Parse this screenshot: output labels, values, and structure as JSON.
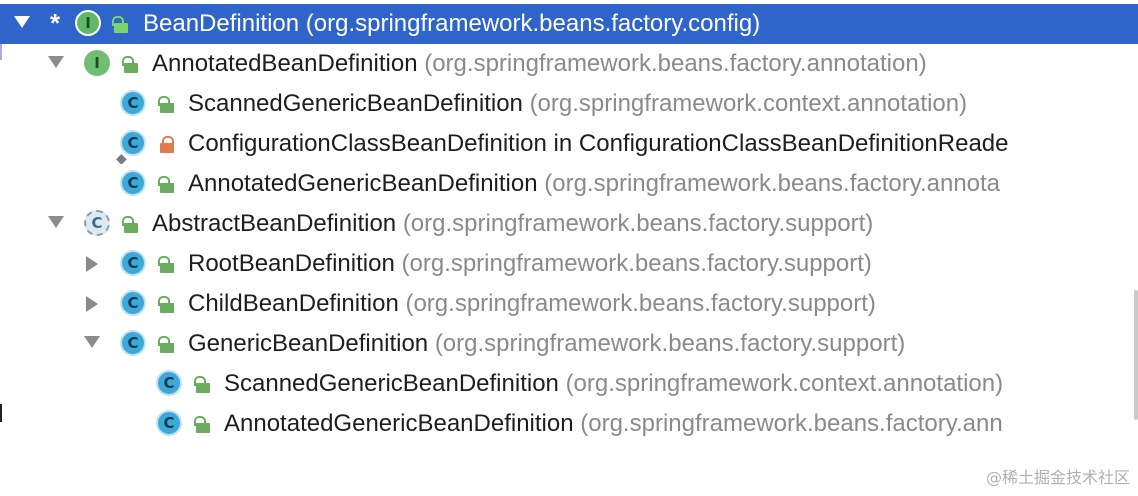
{
  "tree": {
    "rows": [
      {
        "name": "BeanDefinition",
        "pkg": "(org.springframework.beans.factory.config)",
        "kind_letter": "I",
        "kind": "interface",
        "visibility": "public",
        "expanded": true,
        "selected": true,
        "star": "*"
      },
      {
        "name": "AnnotatedBeanDefinition",
        "pkg": "(org.springframework.beans.factory.annotation)",
        "kind_letter": "I",
        "kind": "interface",
        "visibility": "public",
        "expanded": true
      },
      {
        "name": "ScannedGenericBeanDefinition",
        "pkg": "(org.springframework.context.annotation)",
        "kind_letter": "C",
        "kind": "class",
        "visibility": "public"
      },
      {
        "name": "ConfigurationClassBeanDefinition in ConfigurationClassBeanDefinitionReade",
        "pkg": "",
        "kind_letter": "C",
        "kind": "class",
        "visibility": "private"
      },
      {
        "name": "AnnotatedGenericBeanDefinition",
        "pkg": "(org.springframework.beans.factory.annota",
        "kind_letter": "C",
        "kind": "class",
        "visibility": "public"
      },
      {
        "name": "AbstractBeanDefinition",
        "pkg": "(org.springframework.beans.factory.support)",
        "kind_letter": "C",
        "kind": "abstract-class",
        "visibility": "public",
        "expanded": true
      },
      {
        "name": "RootBeanDefinition",
        "pkg": "(org.springframework.beans.factory.support)",
        "kind_letter": "C",
        "kind": "class",
        "visibility": "public",
        "expanded": false
      },
      {
        "name": "ChildBeanDefinition",
        "pkg": "(org.springframework.beans.factory.support)",
        "kind_letter": "C",
        "kind": "class",
        "visibility": "public",
        "expanded": false
      },
      {
        "name": "GenericBeanDefinition",
        "pkg": "(org.springframework.beans.factory.support)",
        "kind_letter": "C",
        "kind": "class",
        "visibility": "public",
        "expanded": true
      },
      {
        "name": "ScannedGenericBeanDefinition",
        "pkg": "(org.springframework.context.annotation)",
        "kind_letter": "C",
        "kind": "class",
        "visibility": "public"
      },
      {
        "name": "AnnotatedGenericBeanDefinition",
        "pkg": "(org.springframework.beans.factory.ann",
        "kind_letter": "C",
        "kind": "class",
        "visibility": "public"
      }
    ]
  },
  "watermark": "@稀土掘金技术社区",
  "colors": {
    "selection": "#2f65ca",
    "interface_icon": "#6fbf73",
    "class_icon": "#3ea8d8",
    "public_lock": "#6aab5d",
    "private_lock": "#e07a4f"
  }
}
